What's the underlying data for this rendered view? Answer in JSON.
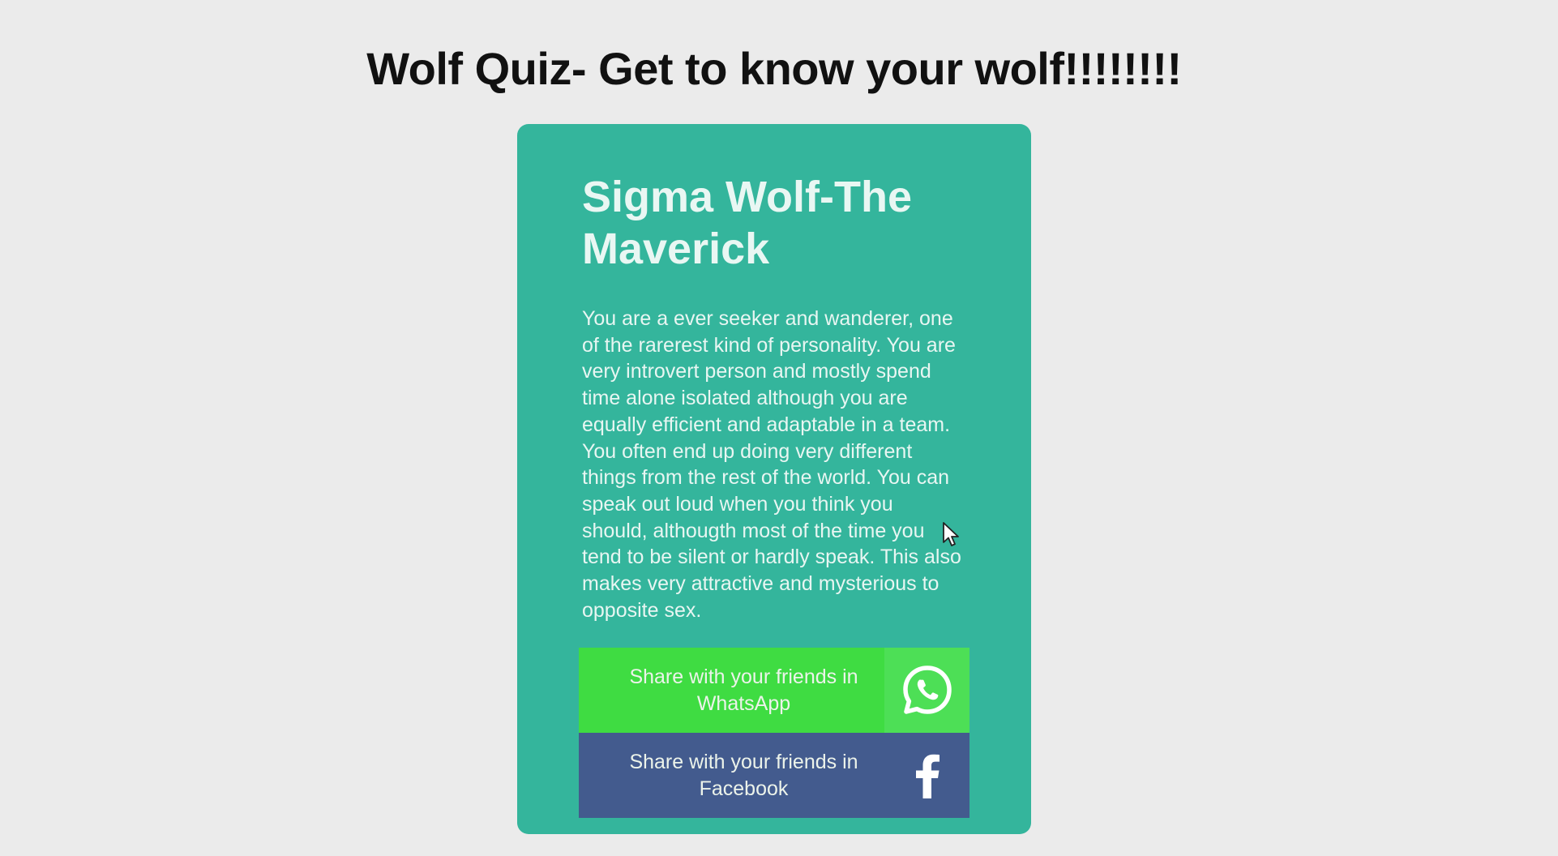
{
  "page": {
    "title": "Wolf Quiz- Get to know your wolf!!!!!!!!"
  },
  "result": {
    "title_line1": "Sigma Wolf-The",
    "title_line2": "Maverick",
    "description_lines": [
      "You are a ever seeker and wanderer, one",
      "of the rarerest kind of personality. You are",
      "very introvert person and mostly spend",
      "time alone isolated although you are",
      "equally efficient and adaptable in a team.",
      "You often end up doing very different",
      "things from the rest of the world. You can",
      "speak out loud when you think you",
      "should, althougth most of the time you",
      "tend to be silent or hardly speak. This also",
      "makes very attractive and mysterious to",
      "opposite sex."
    ]
  },
  "share": {
    "whatsapp": {
      "label_line1": "Share with your friends in",
      "label_line2": "WhatsApp",
      "icon": "whatsapp-icon"
    },
    "facebook": {
      "label_line1": "Share with your friends in",
      "label_line2": "Facebook",
      "icon": "facebook-icon"
    }
  },
  "colors": {
    "background": "#ebebeb",
    "card": "#34b59c",
    "whatsapp": "#3fdc42",
    "facebook": "#435b8e"
  }
}
